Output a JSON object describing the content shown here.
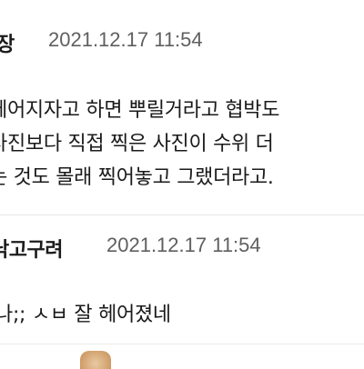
{
  "comments": [
    {
      "author": "장",
      "timestamp": "2021.12.17 11:54",
      "lines": [
        "헤어지자고 하면 뿌릴거라고 협박도",
        "사진보다 직접 찍은 사진이 수위 더",
        "는 것도 몰래 찍어놓고 그랬더라고."
      ]
    },
    {
      "author": "낙고구려",
      "timestamp": "2021.12.17 11:54",
      "lines": [
        "나;; ㅅㅂ 잘 헤어졌네"
      ]
    }
  ]
}
